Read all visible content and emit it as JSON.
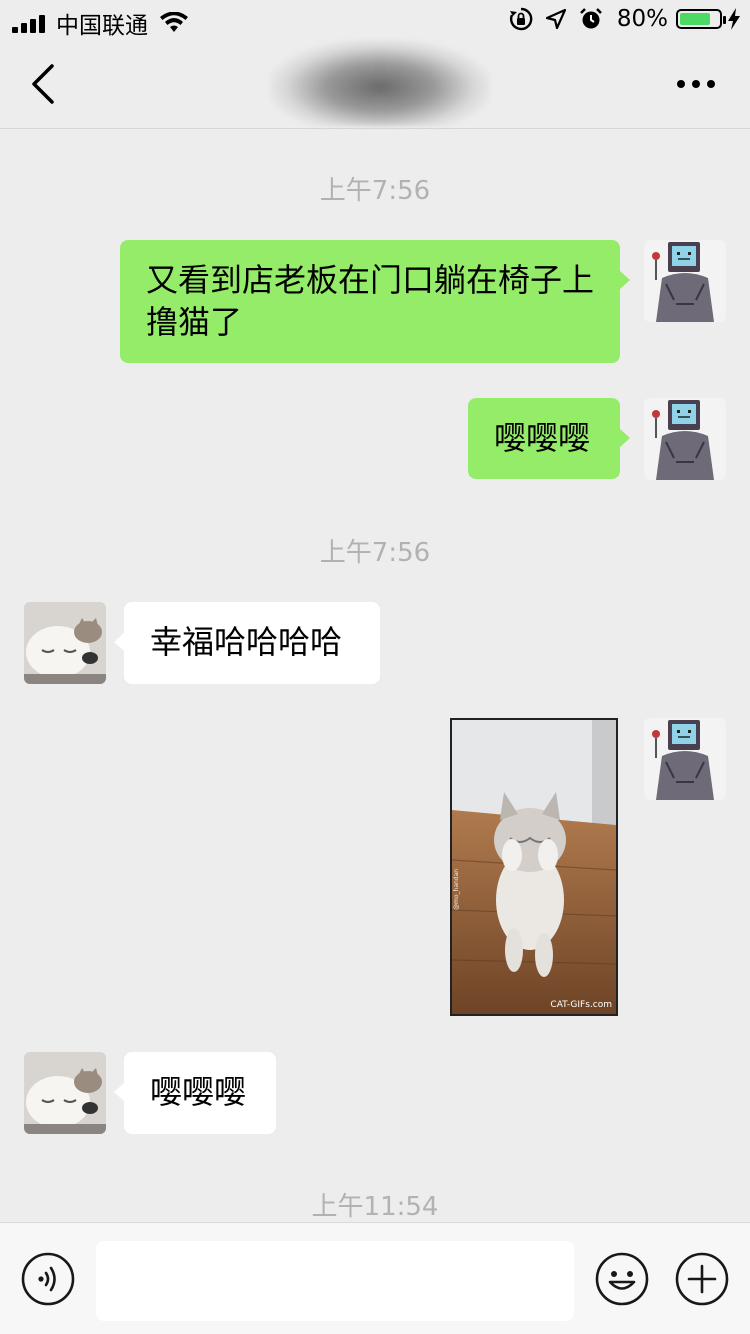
{
  "status_bar": {
    "carrier": "中国联通",
    "battery_percent_label": "80%",
    "battery_level": 0.8,
    "icons": [
      "signal-icon",
      "wifi-icon",
      "lock-rotation-icon",
      "location-icon",
      "alarm-icon",
      "battery-icon",
      "charging-icon"
    ]
  },
  "nav": {
    "back_icon": "chevron-left-icon",
    "more_icon": "more-icon"
  },
  "chat": {
    "timestamps": [
      "上午7:56",
      "上午7:56",
      "上午11:54"
    ],
    "messages": [
      {
        "from": "me",
        "type": "text",
        "text": "又看到店老板在门口躺在椅子上撸猫了"
      },
      {
        "from": "me",
        "type": "text",
        "text": "嘤嘤嘤"
      },
      {
        "from": "them",
        "type": "text",
        "text": "幸福哈哈哈哈"
      },
      {
        "from": "me",
        "type": "image",
        "caption": "CAT-GIFs.com",
        "watermark": "@mo_handan"
      },
      {
        "from": "them",
        "type": "text",
        "text": "嘤嘤嘤"
      }
    ]
  },
  "input_bar": {
    "text_value": "",
    "icons": [
      "voice-icon",
      "emoji-icon",
      "plus-icon"
    ]
  },
  "colors": {
    "background": "#ededed",
    "my_bubble": "#95ec69",
    "their_bubble": "#ffffff",
    "timestamp_text": "#b2b2b2",
    "battery_fill": "#4cd964"
  }
}
